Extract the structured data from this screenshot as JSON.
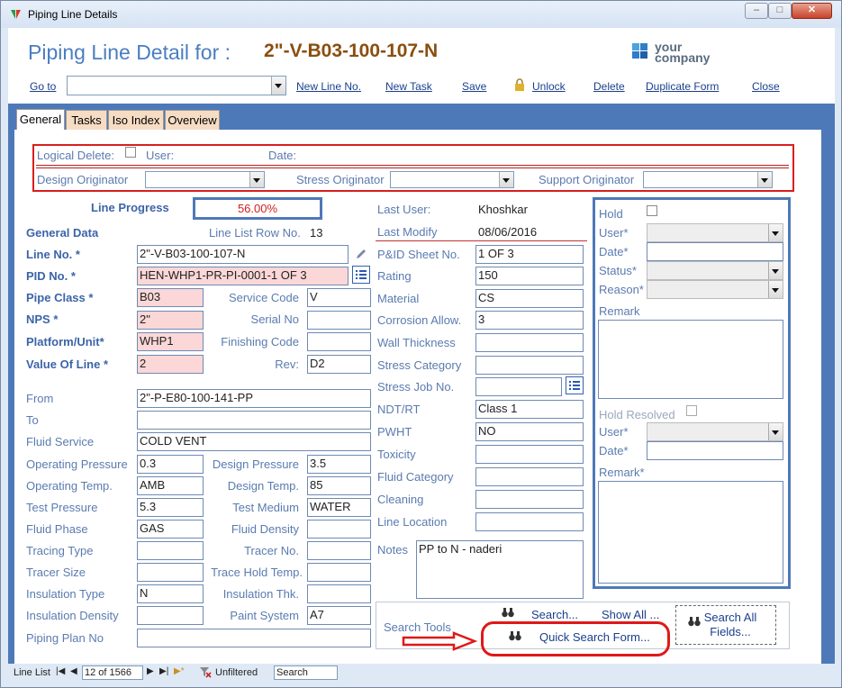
{
  "window": {
    "title": "Piping Line Details"
  },
  "header": {
    "title": "Piping Line Detail for :",
    "line_number": "2\"-V-B03-100-107-N",
    "logo_line1": "your",
    "logo_line2": "company"
  },
  "toolbar": {
    "goto": "Go to",
    "new_line": "New Line No.",
    "new_task": "New Task",
    "save": "Save",
    "unlock": "Unlock",
    "delete": "Delete",
    "duplicate": "Duplicate Form",
    "close": "Close"
  },
  "tabs": [
    "General",
    "Tasks",
    "Iso Index",
    "Overview"
  ],
  "top": {
    "logical_delete": "Logical Delete:",
    "user": "User:",
    "date": "Date:",
    "design_originator": "Design Originator",
    "stress_originator": "Stress Originator",
    "support_originator": "Support Originator"
  },
  "progress": {
    "label": "Line Progress",
    "value": "56.00%"
  },
  "general": {
    "title": "General Data",
    "row_label": "Line List Row No.",
    "row_value": "13"
  },
  "fields": {
    "line_no": {
      "label": "Line No. *",
      "value": "2\"-V-B03-100-107-N"
    },
    "pid_no": {
      "label": "PID No. *",
      "value": "HEN-WHP1-PR-PI-0001-1 OF 3"
    },
    "pipe_class": {
      "label": "Pipe Class *",
      "value": "B03"
    },
    "nps": {
      "label": "NPS *",
      "value": "2\""
    },
    "platform": {
      "label": "Platform/Unit*",
      "value": "WHP1"
    },
    "value_of_line": {
      "label": "Value Of Line *",
      "value": "2"
    },
    "service_code": {
      "label": "Service Code",
      "value": "V"
    },
    "serial_no": {
      "label": "Serial No",
      "value": ""
    },
    "finishing_code": {
      "label": "Finishing Code",
      "value": ""
    },
    "rev": {
      "label": "Rev:",
      "value": "D2"
    },
    "from": {
      "label": "From",
      "value": "2\"-P-E80-100-141-PP"
    },
    "to": {
      "label": "To",
      "value": ""
    },
    "fluid_service": {
      "label": "Fluid Service",
      "value": "COLD VENT"
    },
    "op_pressure": {
      "label": "Operating Pressure",
      "value": "0.3"
    },
    "design_pressure": {
      "label": "Design Pressure",
      "value": "3.5"
    },
    "op_temp": {
      "label": "Operating Temp.",
      "value": "AMB"
    },
    "design_temp": {
      "label": "Design Temp.",
      "value": "85"
    },
    "test_pressure": {
      "label": "Test Pressure",
      "value": "5.3"
    },
    "test_medium": {
      "label": "Test Medium",
      "value": "WATER"
    },
    "fluid_phase": {
      "label": "Fluid Phase",
      "value": "GAS"
    },
    "fluid_density": {
      "label": "Fluid Density",
      "value": ""
    },
    "tracing_type": {
      "label": "Tracing Type",
      "value": ""
    },
    "tracer_no": {
      "label": "Tracer No.",
      "value": ""
    },
    "tracer_size": {
      "label": "Tracer Size",
      "value": ""
    },
    "trace_hold_temp": {
      "label": "Trace Hold Temp.",
      "value": ""
    },
    "insulation_type": {
      "label": "Insulation Type",
      "value": "N"
    },
    "insulation_thk": {
      "label": "Insulation Thk.",
      "value": ""
    },
    "insulation_density": {
      "label": "Insulation Density",
      "value": ""
    },
    "paint_system": {
      "label": "Paint System",
      "value": "A7"
    },
    "piping_plan": {
      "label": "Piping Plan No",
      "value": ""
    }
  },
  "mid": {
    "last_user": {
      "label": "Last User:",
      "value": "Khoshkar"
    },
    "last_modify": {
      "label": "Last Modify",
      "value": "08/06/2016"
    },
    "pid_sheet": {
      "label": "P&ID Sheet No.",
      "value": "1 OF 3"
    },
    "rating": {
      "label": "Rating",
      "value": "150"
    },
    "material": {
      "label": "Material",
      "value": "CS"
    },
    "corrosion": {
      "label": "Corrosion Allow.",
      "value": "3"
    },
    "wall_thickness": {
      "label": "Wall Thickness",
      "value": ""
    },
    "stress_category": {
      "label": "Stress Category",
      "value": ""
    },
    "stress_job": {
      "label": "Stress Job No.",
      "value": ""
    },
    "ndt_rt": {
      "label": "NDT/RT",
      "value": "Class 1"
    },
    "pwht": {
      "label": "PWHT",
      "value": "NO"
    },
    "toxicity": {
      "label": "Toxicity",
      "value": ""
    },
    "fluid_category": {
      "label": "Fluid Category",
      "value": ""
    },
    "cleaning": {
      "label": "Cleaning",
      "value": ""
    },
    "line_location": {
      "label": "Line Location",
      "value": ""
    },
    "notes": {
      "label": "Notes",
      "value": "PP to N - naderi"
    }
  },
  "hold": {
    "hold": "Hold",
    "user": "User*",
    "date": "Date*",
    "status": "Status*",
    "reason": "Reason*",
    "remark": "Remark",
    "hold_resolved": "Hold Resolved",
    "user2": "User*",
    "date2": "Date*",
    "remark2": "Remark*"
  },
  "search": {
    "tools": "Search Tools",
    "search": "Search...",
    "show_all": "Show All ...",
    "search_all": "Search All Fields...",
    "quick": "Quick Search Form..."
  },
  "statusbar": {
    "label": "Line List",
    "record": "12 of 1566",
    "filter": "Unfiltered",
    "search": "Search"
  },
  "colors": {
    "accent": "#4e79b8",
    "highlight": "#e02020"
  }
}
